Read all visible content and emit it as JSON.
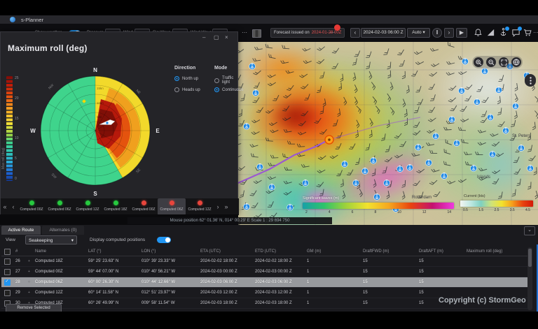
{
  "window": {
    "title": "s-Planner"
  },
  "toolbar": {
    "show_weather": "Show weather",
    "layers": [
      {
        "label": "Pressure"
      },
      {
        "label": "Wind"
      },
      {
        "label": "Sig Wave"
      },
      {
        "label": "Wind Wave"
      }
    ],
    "more": "⋯",
    "forecast_prefix": "Forecast issued on",
    "forecast_date": "2024-01-28 00Z",
    "more2": "⋯",
    "nav_prev": "‹",
    "datetime": "2024-02-03 06:00 Z",
    "auto": "Auto",
    "auto_caret": "▾",
    "nav_next": "›",
    "more3": "⋯"
  },
  "roll_panel": {
    "title": "Maximum roll (deg)",
    "win_min": "–",
    "win_max": "▢",
    "win_close": "×",
    "direction": {
      "label": "Direction",
      "options": [
        {
          "label": "North up",
          "selected": true
        },
        {
          "label": "Heads up",
          "selected": false
        }
      ]
    },
    "mode": {
      "label": "Mode",
      "options": [
        {
          "label": "Traffic light",
          "selected": false
        },
        {
          "label": "Continuous",
          "selected": true
        }
      ]
    },
    "compass": {
      "n": "N",
      "e": "E",
      "s": "S",
      "w": "W",
      "ne": "NE",
      "se": "SE",
      "sw": "SW",
      "nw": "NW"
    },
    "rings": [
      "15kn",
      "10kn",
      "5kn"
    ],
    "colorbar": {
      "ticks": [
        "25",
        "20",
        "15",
        "10",
        "5",
        "0"
      ],
      "label": "Max roll (deg)"
    }
  },
  "computed_tabs": {
    "prev_all": "«",
    "prev": "‹",
    "next": "›",
    "next_all": "»",
    "items": [
      {
        "label": "Computed 00Z",
        "status": "green"
      },
      {
        "label": "Computed 06Z",
        "status": "green"
      },
      {
        "label": "Computed 12Z",
        "status": "green"
      },
      {
        "label": "Computed 18Z",
        "status": "green"
      },
      {
        "label": "Computed 00Z",
        "status": "red"
      },
      {
        "label": "Computed 06Z",
        "status": "red",
        "active": true
      },
      {
        "label": "Computed 12Z",
        "status": "red"
      }
    ]
  },
  "map": {
    "status_text": "Mouse position 62° 01.36' N, 014° 00.29' E    Scale 1 : 29 694 750",
    "labels": {
      "city1": "St. Peters",
      "city2": "Islands",
      "city3": "Rotterdam"
    },
    "legend_waves": {
      "title": "Significant waves (m)",
      "ticks": [
        "2",
        "4",
        "6",
        "8",
        "10",
        "12",
        "14"
      ]
    },
    "legend_current": {
      "title": "Current (kts)",
      "ticks": [
        "0.5",
        "1.5",
        "2.5",
        "3.5",
        "4.5"
      ]
    }
  },
  "bottom": {
    "tabs": [
      {
        "label": "Active Route"
      },
      {
        "label": "Alternates (0)"
      }
    ],
    "collapse": "⌄",
    "view_label": "View",
    "view_value": "Seakeeping",
    "view_caret": "▾",
    "toggle_label": "Display computed positions",
    "row_icon": "+",
    "columns": {
      "num": "#",
      "name": "Name",
      "lat": "LAT (°)",
      "lon": "LON (°)",
      "eta": "ETA (UTC)",
      "etd": "ETD (UTC)",
      "gm": "GM (m)",
      "fwd": "DraftFWD (m)",
      "aft": "DraftAFT (m)",
      "roll": "Maximum roll (deg)"
    },
    "rows": [
      {
        "num": "26",
        "name": "Computed 18Z",
        "lat": "59° 25' 23.63\" N",
        "lon": "010° 39' 23.33\" W",
        "eta": "2024-02-02 18:00 Z",
        "etd": "2024-02-02 18:00 Z",
        "gm": "1",
        "fwd": "15",
        "aft": "15",
        "roll": "green",
        "selected": false
      },
      {
        "num": "27",
        "name": "Computed 00Z",
        "lat": "59° 44' 07.00\" N",
        "lon": "010° 40' 56.21\" W",
        "eta": "2024-02-03 00:00 Z",
        "etd": "2024-02-03 00:00 Z",
        "gm": "1",
        "fwd": "15",
        "aft": "15",
        "roll": "red",
        "selected": false
      },
      {
        "num": "28",
        "name": "Computed 06Z",
        "lat": "60° 00' 26.30\" N",
        "lon": "010° 44' 12.66\" W",
        "eta": "2024-02-03 06:00 Z",
        "etd": "2024-02-03 06:00 Z",
        "gm": "1",
        "fwd": "15",
        "aft": "15",
        "roll": "red",
        "selected": true
      },
      {
        "num": "29",
        "name": "Computed 12Z",
        "lat": "60° 14' 11.58\" N",
        "lon": "012° 51' 23.97\" W",
        "eta": "2024-02-03 12:00 Z",
        "etd": "2024-02-03 12:00 Z",
        "gm": "1",
        "fwd": "15",
        "aft": "15",
        "roll": "red",
        "selected": false
      },
      {
        "num": "30",
        "name": "Computed 18Z",
        "lat": "60° 26' 49.99\" N",
        "lon": "009° 58' 11.54\" W",
        "eta": "2024-02-03 18:00 Z",
        "etd": "2024-02-03 18:00 Z",
        "gm": "1",
        "fwd": "15",
        "aft": "15",
        "roll": "red",
        "selected": false
      }
    ],
    "remove_button": "Remove Selected",
    "copyright": "Copyright (c) StormGeo"
  },
  "colors": {
    "accent": "#2196f3",
    "green": "#27c93f",
    "red": "#e8453c"
  }
}
